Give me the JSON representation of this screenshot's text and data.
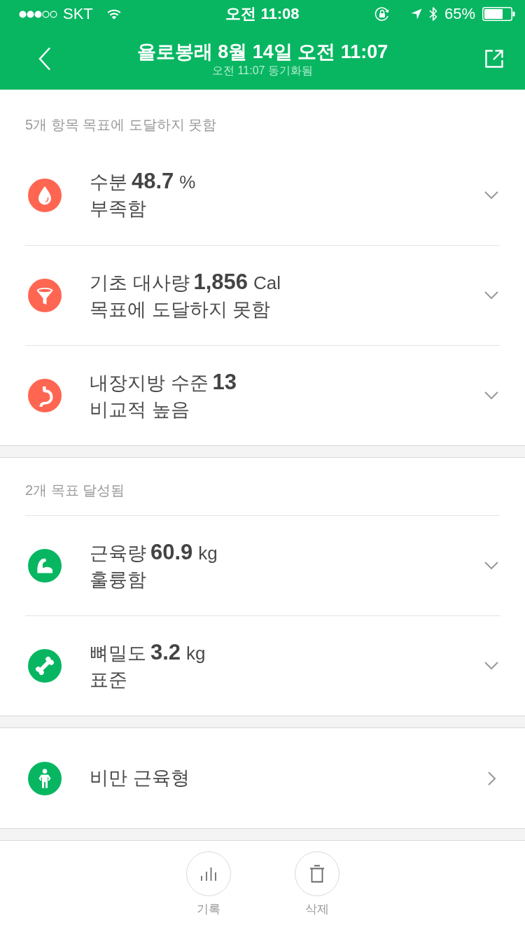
{
  "status_bar": {
    "carrier": "SKT",
    "time": "오전 11:08",
    "battery": "65%"
  },
  "header": {
    "title": "욜로봉래 8월 14일 오전 11:07",
    "subtitle": "오전 11:07 동기화됨"
  },
  "sections": [
    {
      "heading": "5개 항목 목표에 도달하지 못함",
      "items": [
        {
          "kind": "metric",
          "label": "수분",
          "value": "48.7",
          "unit": "%",
          "status": "부족함",
          "color": "#ff6652",
          "expanded": false
        },
        {
          "kind": "metric",
          "label": "기초 대사량",
          "value": "1,856",
          "unit": "Cal",
          "status": "목표에 도달하지 못함",
          "color": "#ff6652",
          "expanded": false
        },
        {
          "kind": "metric",
          "label": "내장지방 수준",
          "value": "13",
          "status": "비교적 높음",
          "color": "#ff6652",
          "expanded": false
        }
      ]
    },
    {
      "heading": "2개 목표 달성됨",
      "items": [
        {
          "kind": "metric",
          "label": "근육량",
          "value": "60.9",
          "unit": "kg",
          "status": "훌륭함",
          "color": "#08b662",
          "expanded": false
        },
        {
          "kind": "metric",
          "label": "뼈밀도",
          "value": "3.2",
          "unit": "kg",
          "status": "표준",
          "color": "#08b662",
          "expanded": false
        }
      ]
    },
    {
      "items": [
        {
          "kind": "link",
          "label": "비만 근육형",
          "color": "#08b662"
        }
      ]
    }
  ],
  "actions": [
    {
      "label": "기록"
    },
    {
      "label": "삭제"
    }
  ]
}
